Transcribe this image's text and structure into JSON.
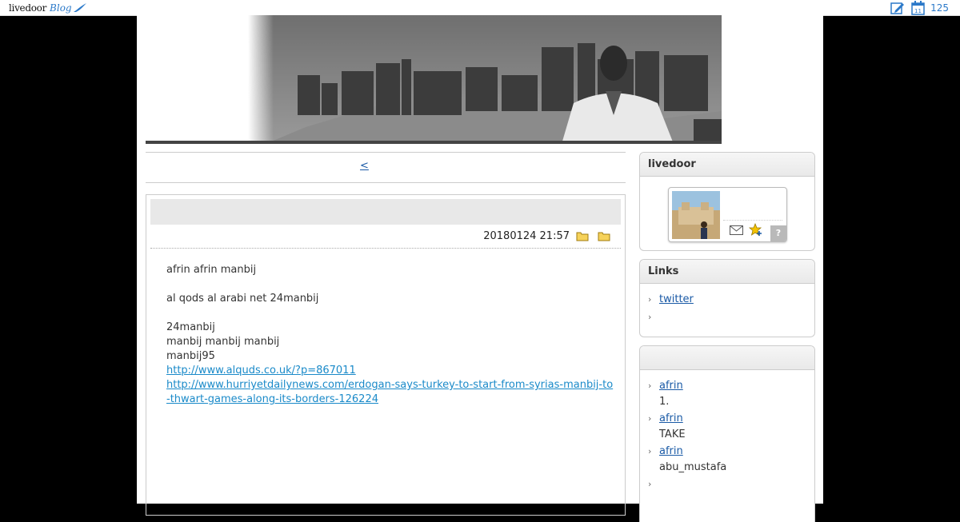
{
  "topbar": {
    "brand_main": "livedoor",
    "brand_sub": "Blog",
    "calendar_day": "11",
    "count": "125"
  },
  "nav": {
    "prev_label": "<"
  },
  "article": {
    "datetime": "20180124 21:57",
    "paragraphs": [
      "afrin afrin manbij",
      "al qods al arabi net 24manbij",
      "24manbij",
      "manbij manbij manbij",
      "manbij95"
    ],
    "links": [
      "http://www.alquds.co.uk/?p=867011",
      "http://www.hurriyetdailynews.com/erdogan-says-turkey-to-start-from-syrias-manbij-to-thwart-games-along-its-borders-126224"
    ]
  },
  "sidebar": {
    "profile_title": "livedoor",
    "help_label": "?",
    "links_title": "Links",
    "links": [
      {
        "label": "twitter"
      },
      {
        "label": ""
      }
    ],
    "recent_title": "",
    "recent": [
      {
        "label": "afrin ",
        "sub": "1."
      },
      {
        "label": "afrin      ",
        "sub": "TAKE"
      },
      {
        "label": "afrin      ",
        "sub": "abu_mustafa"
      },
      {
        "label": "",
        "sub": ""
      }
    ]
  },
  "icons": [
    "edit-icon",
    "calendar-icon",
    "folder-icon",
    "mail-icon",
    "favorite-star-icon",
    "help-icon",
    "arrow-right-icon"
  ],
  "colors": {
    "link": "#1a5aa6",
    "body_link": "#1a8ac9",
    "brand_blue": "#2b79c9",
    "background": "#000000"
  }
}
